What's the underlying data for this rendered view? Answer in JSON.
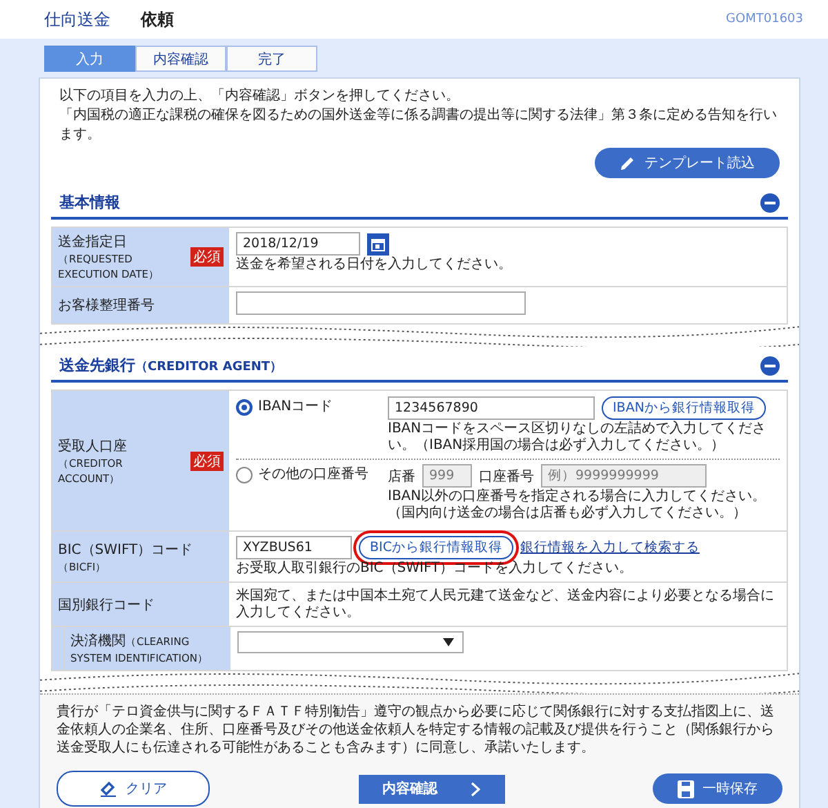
{
  "header": {
    "title": "仕向送金",
    "subtitle": "依頼",
    "screen_id": "GOMT01603"
  },
  "steps": [
    {
      "label": "入力",
      "selected": true
    },
    {
      "label": "内容確認",
      "selected": false
    },
    {
      "label": "完了",
      "selected": false
    }
  ],
  "intro": [
    "以下の項目を入力の上、「内容確認」ボタンを押してください。",
    "「内国税の適正な課税の確保を図るための国外送金等に係る調書の提出等に関する法律」第３条に定める告知を行います。"
  ],
  "template_button": "テンプレート読込",
  "sections": [
    {
      "title": "基本情報",
      "rows": [
        {
          "kind": "date",
          "label": "送金指定日",
          "label_en": "（REQUESTED EXECUTION DATE）",
          "required": "必須",
          "value": "2018/12/19",
          "hint": "送金を希望される日付を入力してください。"
        },
        {
          "kind": "cut",
          "label": "お客様整理番号"
        }
      ],
      "torn": true
    },
    {
      "title": "送金先銀行",
      "title_en": "（CREDITOR AGENT）",
      "rows": [
        {
          "kind": "account",
          "label": "受取人口座",
          "label_en": "（CREDITOR ACCOUNT）",
          "required": "必須",
          "options": [
            {
              "kind": "iban",
              "label": "IBANコード",
              "selected": true,
              "value": "1234567890",
              "button": "IBANから銀行情報取得",
              "hint": "IBANコードをスペース区切りなしの左詰めで入力してください。（IBAN採用国の場合は必ず入力してください。）"
            },
            {
              "kind": "other",
              "label": "その他の口座番号",
              "selected": false,
              "branch_label": "店番",
              "branch_value": "999",
              "account_label": "口座番号",
              "account_placeholder": "例）9999999999",
              "hint": "IBAN以外の口座番号を指定される場合に入力してください。（国内向け送金の場合は店番も必ず入力してください。）"
            }
          ]
        },
        {
          "kind": "bic",
          "label": "BIC（SWIFT）コード",
          "label_en": "（BICFI）",
          "value": "XYZBUS61",
          "button": "BICから銀行情報取得",
          "highlighted": true,
          "link": "銀行情報を入力して検索する",
          "hint": "お受取人取引銀行のBIC（SWIFT）コードを入力してください。"
        },
        {
          "kind": "note",
          "label": "国別銀行コード",
          "text": "米国宛て、または中国本土宛て人民元建て送金など、送金内容により必要となる場合に入力してください。"
        },
        {
          "kind": "select",
          "label": "決済機関",
          "label_en": "（CLEARING SYSTEM IDENTIFICATION）"
        }
      ],
      "torn": true
    }
  ],
  "notice": "貴行が「テロ資金供与に関するＦＡＴＦ特別勧告」遵守の観点から必要に応じて関係銀行に対する支払指図上に、送金依頼人の企業名、住所、口座番号及びその他送金依頼人を特定する情報の記載及び提供を行うこと（関係銀行から送金受取人にも伝達される可能性があることも含みます）に同意し、承諾いたします。",
  "buttons": {
    "clear": "クリア",
    "confirm": "内容確認",
    "save": "一時保存"
  }
}
